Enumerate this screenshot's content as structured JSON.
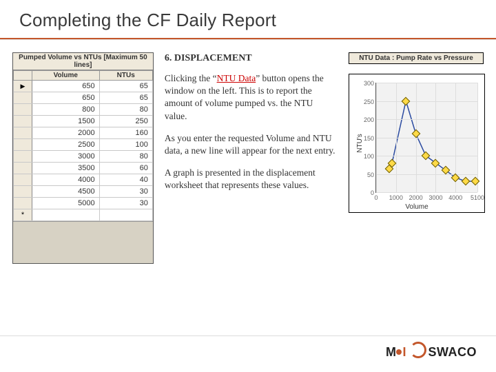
{
  "title": "Completing the CF Daily Report",
  "table": {
    "title": "Pumped Volume vs NTUs [Maximum 50 lines]",
    "columns": [
      "Volume",
      "NTUs"
    ],
    "rows": [
      [
        650,
        65
      ],
      [
        650,
        65
      ],
      [
        800,
        80
      ],
      [
        1500,
        250
      ],
      [
        2000,
        160
      ],
      [
        2500,
        100
      ],
      [
        3000,
        80
      ],
      [
        3500,
        60
      ],
      [
        4000,
        40
      ],
      [
        4500,
        30
      ],
      [
        5000,
        30
      ]
    ]
  },
  "center": {
    "heading": "6.  DISPLACEMENT",
    "p1a": "Clicking the “",
    "link": "NTU Data",
    "p1b": "” button opens the window on the left.  This is to report  the amount of volume pumped vs. the NTU value.",
    "p2": "As you enter the requested Volume and NTU data, a new line will appear for the next entry.",
    "p3": "A graph is presented in the displacement worksheet that represents these values."
  },
  "chart_data": {
    "type": "line",
    "title": "NTU Data : Pump Rate vs Pressure",
    "xlabel": "Volume",
    "ylabel": "NTU's",
    "xlim": [
      0,
      5100
    ],
    "ylim": [
      0,
      300
    ],
    "xticks": [
      0,
      1000,
      2000,
      3000,
      4000,
      5100
    ],
    "yticks": [
      0,
      50,
      100,
      150,
      200,
      250,
      300
    ],
    "series": [
      {
        "name": "NTU",
        "x": [
          650,
          800,
          1500,
          2000,
          2500,
          3000,
          3500,
          4000,
          4500,
          5000
        ],
        "y": [
          65,
          80,
          250,
          160,
          100,
          80,
          60,
          40,
          30,
          30
        ]
      }
    ]
  },
  "logo": {
    "brand_a": "M",
    "brand_i": "I",
    "brand_b": "SWACO"
  }
}
